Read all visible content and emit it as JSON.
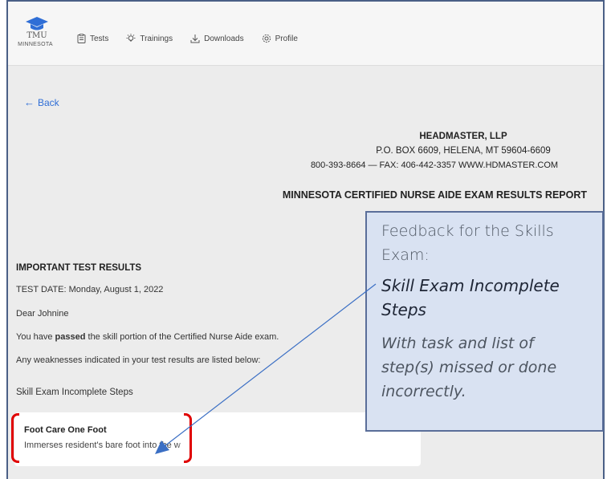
{
  "logo": {
    "line1": "TMU",
    "line2": "MINNESOTA"
  },
  "nav": {
    "tests": "Tests",
    "trainings": "Trainings",
    "downloads": "Downloads",
    "profile": "Profile"
  },
  "back_label": "Back",
  "letterhead": {
    "company": "HEADMASTER, LLP",
    "address": "P.O. BOX 6609, HELENA, MT 59604-6609",
    "contact": "800-393-8664 — FAX: 406-442-3357 WWW.HDMASTER.COM"
  },
  "report_title": "MINNESOTA CERTIFIED NURSE AIDE EXAM RESULTS REPORT",
  "results": {
    "heading": "IMPORTANT TEST RESULTS",
    "test_date": "TEST DATE: Monday, August 1, 2022",
    "greeting": "Dear Johnine",
    "passed_prefix": "You have ",
    "passed_word": "passed",
    "passed_suffix": " the skill portion of the Certified Nurse Aide exam.",
    "weaknesses": "Any weaknesses indicated in your test results are listed below:",
    "section_label": "Skill Exam Incomplete Steps"
  },
  "task_card": {
    "task": "Foot Care One Foot",
    "step": "Immerses resident's bare foot into the w"
  },
  "callout": {
    "line1": "Feedback for the Skills Exam:",
    "line2": "Skill Exam Incomplete Steps",
    "line3": "With task and list of step(s) missed or done incorrectly."
  },
  "colors": {
    "link": "#2f6ed6",
    "callout_bg": "#d9e2f2",
    "callout_border": "#5a6e99",
    "bracket": "#e00000",
    "arrow": "#3b6fc4"
  }
}
